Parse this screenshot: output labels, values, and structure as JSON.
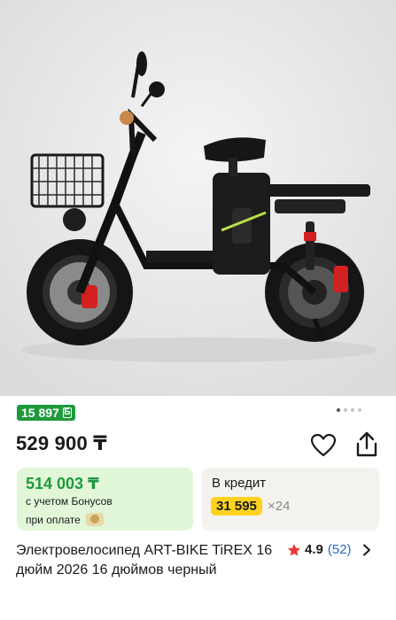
{
  "product": {
    "bonus_badge": "15 897",
    "bonus_badge_currency": "Б",
    "gallery": {
      "total_images": 4,
      "current_index": 1
    },
    "price": "529 900 ₸",
    "bonus_card": {
      "amount": "514 003 ₸",
      "line1": "с учетом Бонусов",
      "line2": "при оплате"
    },
    "credit_card": {
      "title": "В кредит",
      "monthly": "31 595",
      "term": "×24"
    },
    "title": "Электровелосипед ART-BIKE TiREX 16 дюйм 2026 16 дюймов черный",
    "rating": {
      "score": "4.9",
      "count": "(52)"
    }
  },
  "colors": {
    "bonus_green": "#1e9a3b",
    "bonus_card_bg": "#e2f7d8",
    "credit_card_bg": "#f3f2ef",
    "credit_highlight": "#ffd21f",
    "star": "#e53935",
    "link_blue": "#2a66c9"
  },
  "icons": [
    "heart-icon",
    "share-icon",
    "star-icon",
    "chevron-right-icon",
    "bonus-coin-icon"
  ]
}
